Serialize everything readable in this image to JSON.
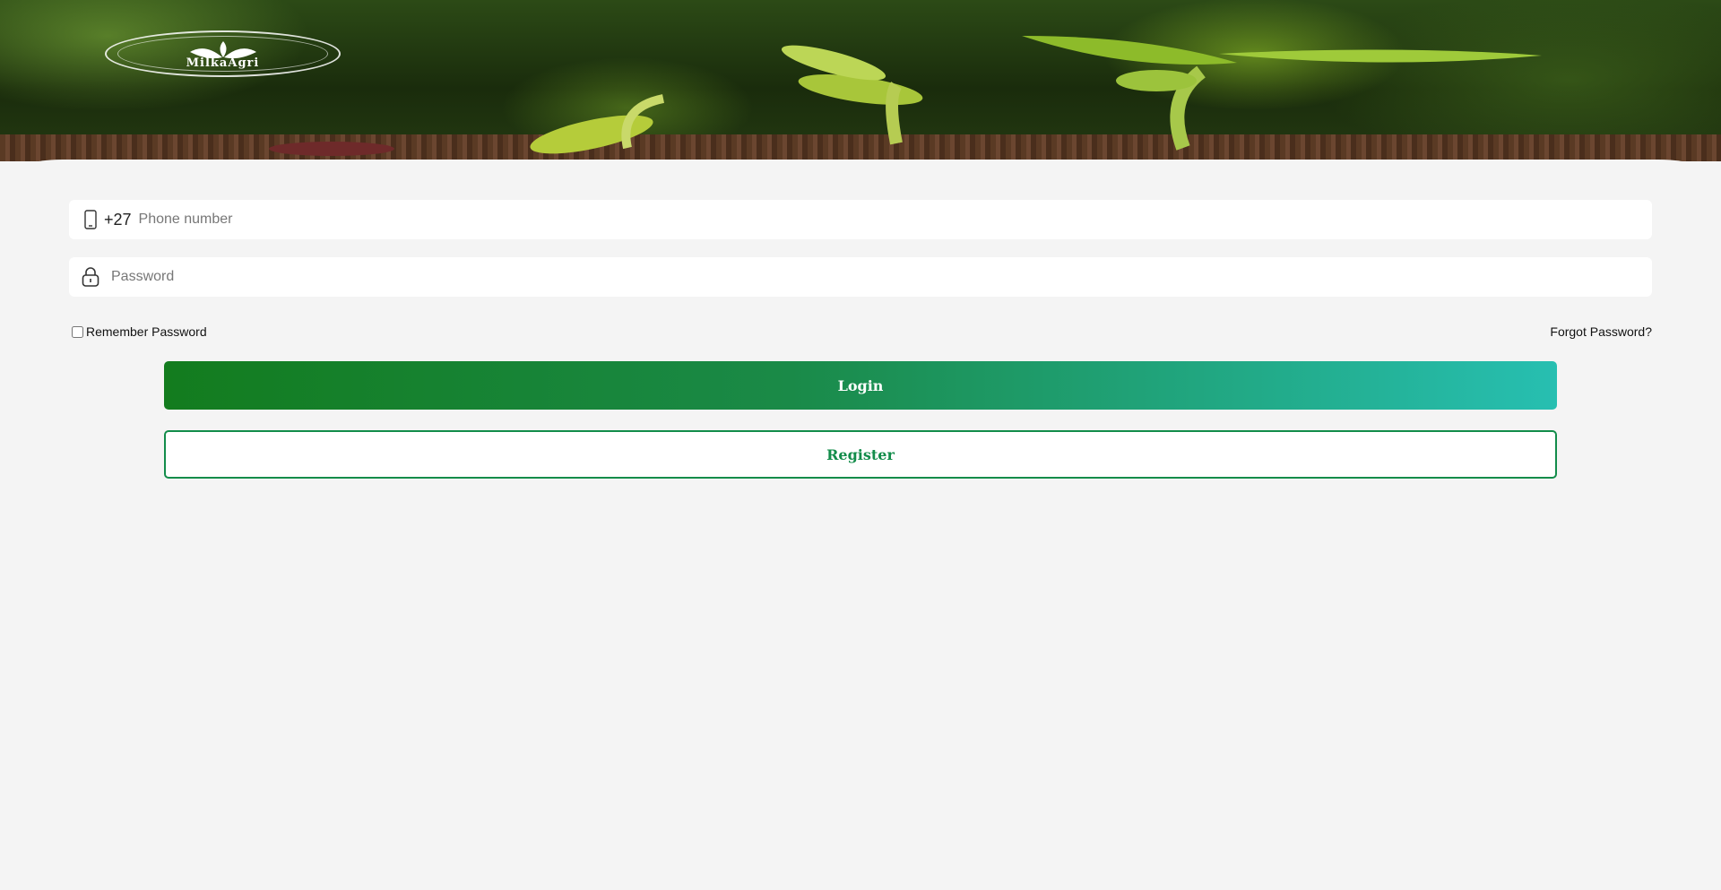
{
  "header": {
    "logo_text": "MilkaAgri"
  },
  "form": {
    "phone": {
      "country_code": "+27",
      "placeholder": "Phone number",
      "value": ""
    },
    "password": {
      "placeholder": "Password",
      "value": ""
    },
    "remember_label": "Remember Password",
    "remember_checked": false,
    "forgot_label": "Forgot Password?",
    "login_label": "Login",
    "register_label": "Register"
  },
  "colors": {
    "primary_green": "#128c4a",
    "login_gradient_start": "#137c1e",
    "login_gradient_end": "#27bfb1",
    "background": "#f4f4f4"
  },
  "icons": {
    "phone": "mobile-phone-icon",
    "password": "lock-icon"
  }
}
